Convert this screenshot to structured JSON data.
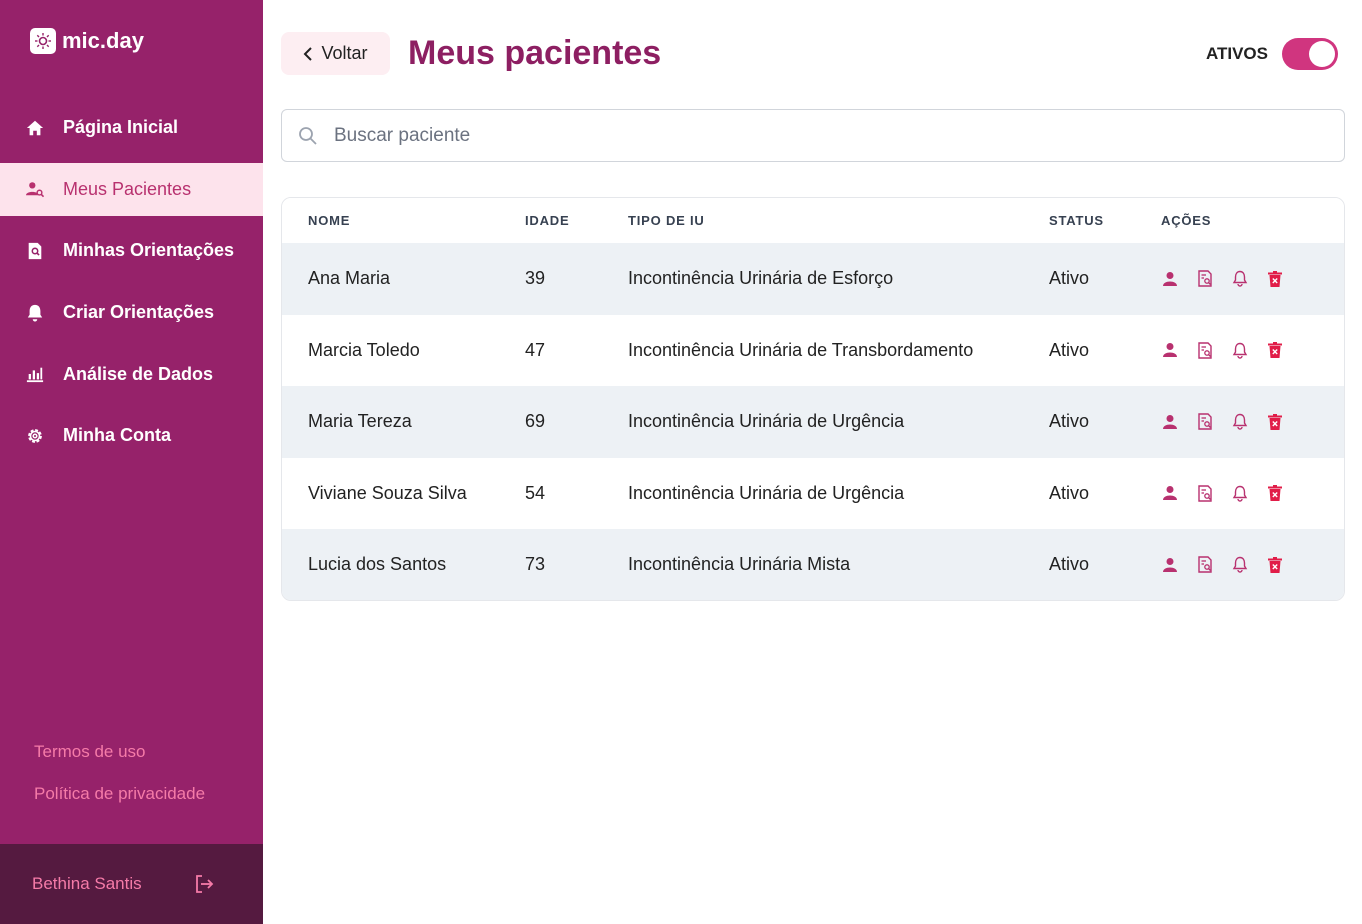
{
  "app": {
    "name": "mic.day"
  },
  "sidebar": {
    "items": [
      {
        "label": "Página Inicial",
        "icon": "home-icon"
      },
      {
        "label": "Meus Pacientes",
        "icon": "patients-icon",
        "active": true
      },
      {
        "label": "Minhas Orientações",
        "icon": "document-search-icon"
      },
      {
        "label": "Criar Orientações",
        "icon": "bell-icon"
      },
      {
        "label": "Análise de Dados",
        "icon": "bar-chart-icon"
      },
      {
        "label": "Minha Conta",
        "icon": "gear-icon"
      }
    ],
    "footer_links": {
      "terms": "Termos de uso",
      "privacy": "Política de privacidade"
    },
    "user": {
      "name": "Bethina Santis"
    }
  },
  "header": {
    "back_label": "Voltar",
    "title": "Meus pacientes",
    "toggle_label": "ATIVOS",
    "toggle_on": true
  },
  "search": {
    "placeholder": "Buscar paciente",
    "value": ""
  },
  "table": {
    "columns": {
      "name": "NOME",
      "age": "IDADE",
      "type": "TIPO DE IU",
      "status": "STATUS",
      "actions": "AÇÕES"
    },
    "rows": [
      {
        "name": "Ana Maria",
        "age": "39",
        "type": "Incontinência Urinária de Esforço",
        "status": "Ativo"
      },
      {
        "name": "Marcia Toledo",
        "age": "47",
        "type": "Incontinência Urinária de Transbordamento",
        "status": "Ativo"
      },
      {
        "name": "Maria Tereza",
        "age": "69",
        "type": "Incontinência Urinária de Urgência",
        "status": "Ativo"
      },
      {
        "name": "Viviane Souza Silva",
        "age": "54",
        "type": "Incontinência Urinária de Urgência",
        "status": "Ativo"
      },
      {
        "name": "Lucia dos Santos",
        "age": "73",
        "type": "Incontinência Urinária Mista",
        "status": "Ativo"
      }
    ]
  },
  "colors": {
    "sidebar": "#96226a",
    "sidebar_active_bg": "#fde3ec",
    "title": "#8d1f62",
    "accent": "#d0357f",
    "delete": "#e11d48"
  }
}
